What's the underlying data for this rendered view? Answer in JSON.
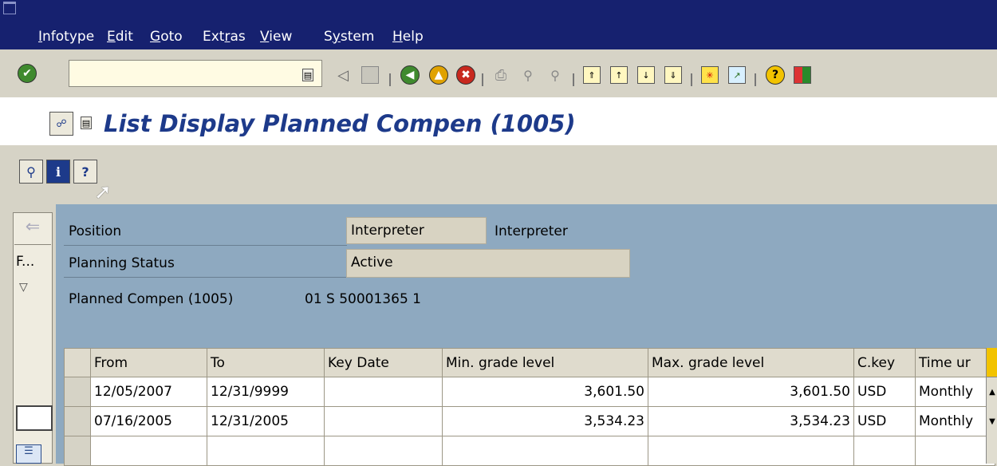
{
  "menu": {
    "items": [
      {
        "label": "Infotype",
        "key": "I",
        "rest": "nfotype"
      },
      {
        "label": "Edit",
        "key": "E",
        "rest": "dit"
      },
      {
        "label": "Goto",
        "key": "G",
        "rest": "oto"
      },
      {
        "label": "Extras",
        "pre": "Ext",
        "key": "r",
        "rest": "as"
      },
      {
        "label": "View",
        "key": "V",
        "rest": "iew"
      },
      {
        "label": "System",
        "pre": "S",
        "key": "y",
        "rest": "stem"
      },
      {
        "label": "Help",
        "key": "H",
        "rest": "elp"
      }
    ]
  },
  "toolbar": {
    "command_value": "",
    "icons": [
      "enter-icon",
      "command-history-icon",
      "back-arrow-icon",
      "save-icon",
      "back-icon",
      "exit-icon",
      "cancel-icon",
      "print-icon",
      "find-icon",
      "find-next-icon",
      "first-page-icon",
      "previous-page-icon",
      "next-page-icon",
      "last-page-icon",
      "new-session-icon",
      "shortcut-icon",
      "help-icon",
      "customize-layout-icon"
    ]
  },
  "page": {
    "title": "List Display Planned Compen (1005)"
  },
  "app_toolbar": {
    "icons": [
      "overview-icon",
      "info-icon",
      "help-context-icon"
    ]
  },
  "side": {
    "label": "F..."
  },
  "header": {
    "position_label": "Position",
    "position_value": "Interpreter",
    "position_text": "Interpreter",
    "status_label": "Planning Status",
    "status_value": "Active",
    "infotype_label": "Planned Compen (1005)",
    "infotype_key": "01 S 50001365 1"
  },
  "table": {
    "columns": [
      "From",
      "To",
      "Key Date",
      "Min. grade level",
      "Max. grade level",
      "C.key",
      "Time ur"
    ],
    "rows": [
      {
        "from": "12/05/2007",
        "to": "12/31/9999",
        "key_date": "",
        "min": "3,601.50",
        "max": "3,601.50",
        "ckey": "USD",
        "time": "Monthly"
      },
      {
        "from": "07/16/2005",
        "to": "12/31/2005",
        "key_date": "",
        "min": "3,534.23",
        "max": "3,534.23",
        "ckey": "USD",
        "time": "Monthly"
      }
    ]
  },
  "colors": {
    "menubar": "#16216f",
    "title": "#1d3a8a",
    "main_bg": "#8ea9c0"
  }
}
